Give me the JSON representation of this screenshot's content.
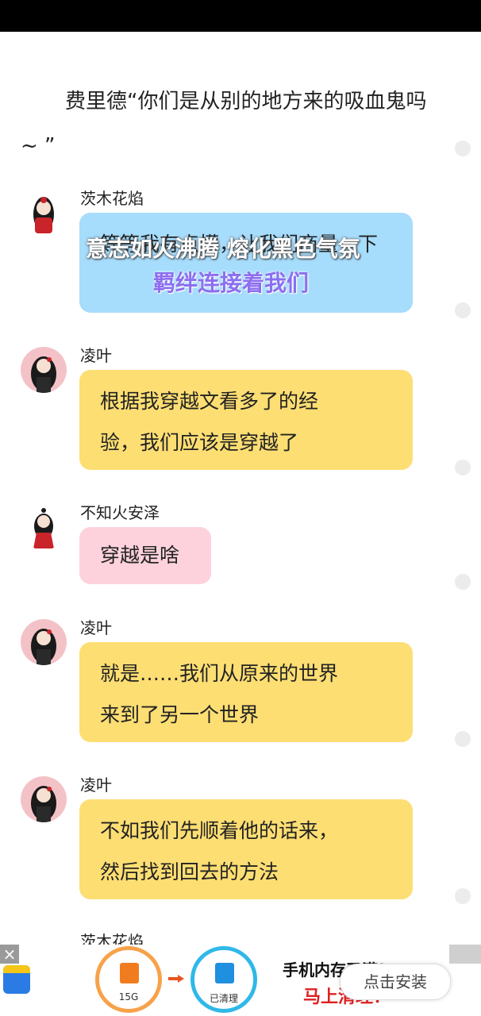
{
  "narration": "费里德“你们是从别的地方来的吸血鬼吗 ~ ”",
  "messages": [
    {
      "name": "茨木花焰",
      "text": "等等我有点懵，让我们商量一下"
    },
    {
      "name": "凌叶",
      "text_line1": "根据我穿越文看多了的经",
      "text_line2": "验，我们应该是穿越了"
    },
    {
      "name": "不知火安泽",
      "text": "穿越是啥"
    },
    {
      "name": "凌叶",
      "text_line1": "就是……我们从原来的世界",
      "text_line2": "来到了另一个世界"
    },
    {
      "name": "凌叶",
      "text_line1": "不如我们先顺着他的话来，",
      "text_line2": "然后找到回去的方法"
    },
    {
      "name": "茨木花焰"
    }
  ],
  "overlay_lyrics": {
    "line1": "意志如火沸腾 熔化黑色气氛",
    "line2": "羁绊连接着我们"
  },
  "ad": {
    "close": "×",
    "before_label": "15G",
    "after_label": "已清理",
    "headline": "手机内存已满！",
    "subline": "马上清理！",
    "install_button": "点击安装"
  },
  "colors": {
    "bubble_blue": "#a6dcfc",
    "bubble_yellow": "#fdde73",
    "bubble_pink": "#fdd2dc",
    "lyric_purple": "#8c6ef0",
    "ad_red": "#e02020"
  }
}
